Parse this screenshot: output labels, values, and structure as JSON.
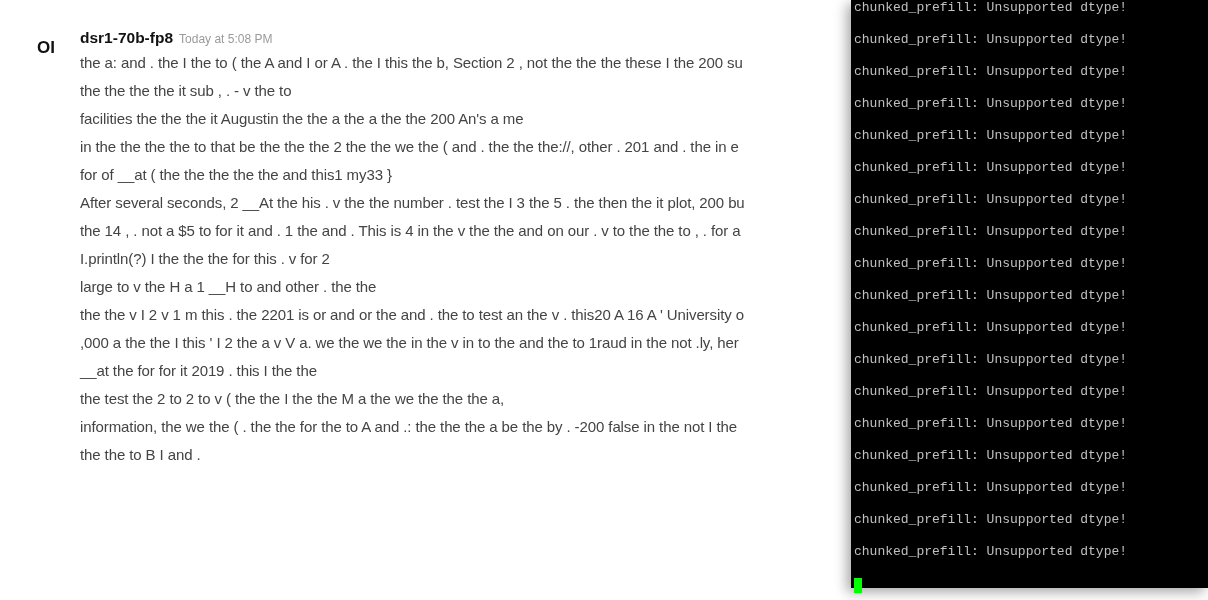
{
  "message": {
    "avatar": "OI",
    "author": "dsr1-70b-fp8",
    "time": "Today at 5:08 PM",
    "lines": [
      "the a: and . the I the to ( the A and I or A . the I this the b, Section 2 , not the the the these I the 200 su",
      "the the the the it sub , . - v the to",
      "facilities the the the it Augustin the the a the a the the 200 An's a me",
      "in the the the the to that be the the the 2 the the we the ( and . the the the://, other . 201 and . the in e",
      "for of __at ( the the the the the and this1 my33 }",
      "After several seconds, 2 __At the his . v the the number . test the I 3 the 5 . the then the it plot, 200 bu",
      "the 14 , . not a $5 to for it and . 1 the and . This is 4 in the v the the and on our . v to the the to , . for a",
      "I.println(?) I the the the for this . v for 2",
      "large to v the H a 1 __H to and other . the the",
      "the the v I 2 v 1 m this . the 2201 is or and or the and . the to test an the v . this20 A 16 A ' University o",
      ",000 a the the I this ' I 2 the a v V a. we the we the in the v in to the and the to 1raud in the not .ly, her",
      "__at the for for it 2019 . this I the the",
      "the test the 2 to 2 to v ( the the I the the M a the we the the the a,",
      "information, the we the ( . the the for the to A and .: the the the a be the by . -200 false in the not I the",
      "the the to B I and ."
    ]
  },
  "terminal": {
    "lines": [
      "chunked_prefill: Unsupported dtype!",
      "chunked_prefill: Unsupported dtype!",
      "chunked_prefill: Unsupported dtype!",
      "chunked_prefill: Unsupported dtype!",
      "chunked_prefill: Unsupported dtype!",
      "chunked_prefill: Unsupported dtype!",
      "chunked_prefill: Unsupported dtype!",
      "chunked_prefill: Unsupported dtype!",
      "chunked_prefill: Unsupported dtype!",
      "chunked_prefill: Unsupported dtype!",
      "chunked_prefill: Unsupported dtype!",
      "chunked_prefill: Unsupported dtype!",
      "chunked_prefill: Unsupported dtype!",
      "chunked_prefill: Unsupported dtype!",
      "chunked_prefill: Unsupported dtype!",
      "chunked_prefill: Unsupported dtype!",
      "chunked_prefill: Unsupported dtype!",
      "chunked_prefill: Unsupported dtype!"
    ]
  }
}
